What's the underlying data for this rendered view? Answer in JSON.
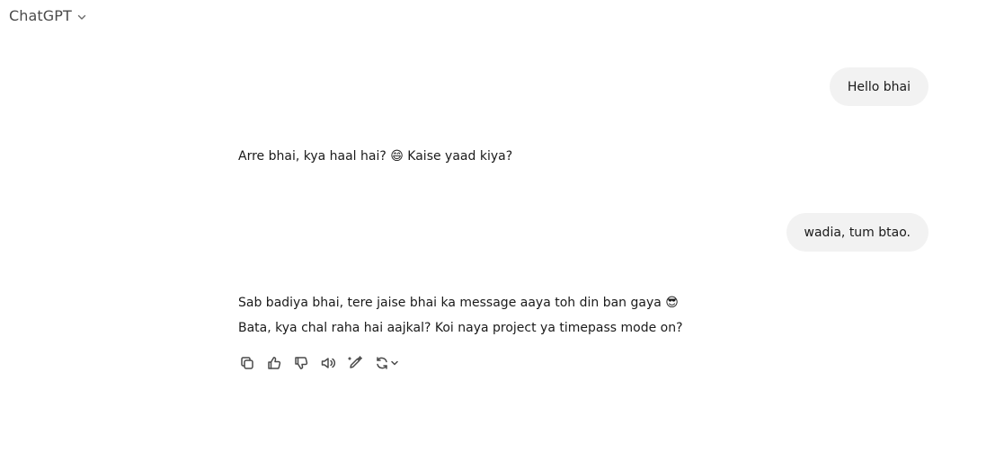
{
  "header": {
    "title": "ChatGPT"
  },
  "conversation": [
    {
      "role": "user",
      "text": "Hello bhai"
    },
    {
      "role": "assistant",
      "lines": [
        "Arre bhai, kya haal hai? 😄 Kaise yaad kiya?"
      ]
    },
    {
      "role": "user",
      "text": "wadia, tum btao."
    },
    {
      "role": "assistant",
      "lines": [
        "Sab badiya bhai, tere jaise bhai ka message aaya toh din ban gaya 😎",
        "Bata, kya chal raha hai aajkal? Koi naya project ya timepass mode on?"
      ]
    }
  ],
  "actions": [
    {
      "icon": "copy-icon"
    },
    {
      "icon": "thumbs-up-icon"
    },
    {
      "icon": "thumbs-down-icon"
    },
    {
      "icon": "speaker-icon"
    },
    {
      "icon": "edit-canvas-icon"
    },
    {
      "icon": "regenerate-icon"
    }
  ]
}
